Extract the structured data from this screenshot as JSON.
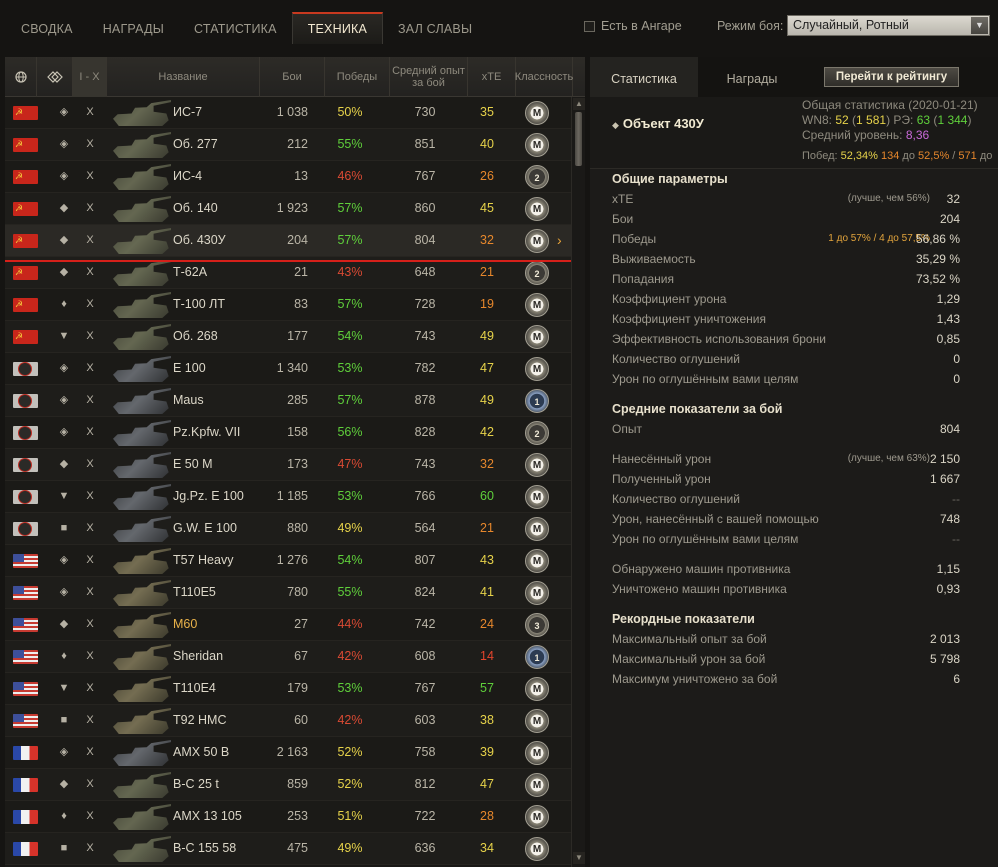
{
  "nav": {
    "tabs": [
      "СВОДКА",
      "НАГРАДЫ",
      "СТАТИСТИКА",
      "ТЕХНИКА",
      "ЗАЛ СЛАВЫ"
    ],
    "active_tab": 3,
    "hangar_label": "Есть в Ангаре",
    "mode_label": "Режим боя:",
    "mode_value": "Случайный, Ротный"
  },
  "table": {
    "headers": {
      "flag_icon": "globe-icon",
      "tier_icon": "tier-icon",
      "level": "I - X",
      "name": "Название",
      "battles": "Бои",
      "wins": "Победы",
      "exp": "Средний опыт за бой",
      "xte": "xTE",
      "class": "Классность"
    },
    "rows": [
      {
        "nation": "ussr",
        "tier": "◈",
        "level": "X",
        "name": "ИС-7",
        "battles": "1 038",
        "wins": "50%",
        "wc": "y",
        "exp": "730",
        "xte": "35",
        "xc": "y",
        "cls": "M",
        "ck": "m",
        "tank": ""
      },
      {
        "nation": "ussr",
        "tier": "◈",
        "level": "X",
        "name": "Об. 277",
        "battles": "212",
        "wins": "55%",
        "wc": "g",
        "exp": "851",
        "xte": "40",
        "xc": "y",
        "cls": "M",
        "ck": "m",
        "tank": ""
      },
      {
        "nation": "ussr",
        "tier": "◈",
        "level": "X",
        "name": "ИС-4",
        "battles": "13",
        "wins": "46%",
        "wc": "lr",
        "exp": "767",
        "xte": "26",
        "xc": "o",
        "cls": "2",
        "ck": "",
        "tank": ""
      },
      {
        "nation": "ussr",
        "tier": "◆",
        "level": "X",
        "name": "Об. 140",
        "battles": "1 923",
        "wins": "57%",
        "wc": "g",
        "exp": "860",
        "xte": "45",
        "xc": "y",
        "cls": "M",
        "ck": "m",
        "tank": ""
      },
      {
        "nation": "ussr",
        "tier": "◆",
        "level": "X",
        "name": "Об. 430У",
        "battles": "204",
        "wins": "57%",
        "wc": "g",
        "exp": "804",
        "xte": "32",
        "xc": "o",
        "cls": "M",
        "ck": "m",
        "tank": "",
        "selected": true
      },
      {
        "nation": "ussr",
        "tier": "◆",
        "level": "X",
        "name": "Т-62А",
        "battles": "21",
        "wins": "43%",
        "wc": "lr",
        "exp": "648",
        "xte": "21",
        "xc": "o",
        "cls": "2",
        "ck": "",
        "tank": ""
      },
      {
        "nation": "ussr",
        "tier": "♦",
        "level": "X",
        "name": "Т-100 ЛТ",
        "battles": "83",
        "wins": "57%",
        "wc": "g",
        "exp": "728",
        "xte": "19",
        "xc": "o",
        "cls": "M",
        "ck": "m",
        "tank": ""
      },
      {
        "nation": "ussr",
        "tier": "▼",
        "level": "X",
        "name": "Об. 268",
        "battles": "177",
        "wins": "54%",
        "wc": "g",
        "exp": "743",
        "xte": "49",
        "xc": "y",
        "cls": "M",
        "ck": "m",
        "tank": ""
      },
      {
        "nation": "ger",
        "tier": "◈",
        "level": "X",
        "name": "E 100",
        "battles": "1 340",
        "wins": "53%",
        "wc": "g",
        "exp": "782",
        "xte": "47",
        "xc": "y",
        "cls": "M",
        "ck": "m",
        "tank": "grey"
      },
      {
        "nation": "ger",
        "tier": "◈",
        "level": "X",
        "name": "Maus",
        "battles": "285",
        "wins": "57%",
        "wc": "g",
        "exp": "878",
        "xte": "49",
        "xc": "y",
        "cls": "1",
        "ck": "one",
        "tank": "grey"
      },
      {
        "nation": "ger",
        "tier": "◈",
        "level": "X",
        "name": "Pz.Kpfw. VII",
        "battles": "158",
        "wins": "56%",
        "wc": "g",
        "exp": "828",
        "xte": "42",
        "xc": "y",
        "cls": "2",
        "ck": "",
        "tank": "grey"
      },
      {
        "nation": "ger",
        "tier": "◆",
        "level": "X",
        "name": "E 50 M",
        "battles": "173",
        "wins": "47%",
        "wc": "lr",
        "exp": "743",
        "xte": "32",
        "xc": "o",
        "cls": "M",
        "ck": "m",
        "tank": "grey"
      },
      {
        "nation": "ger",
        "tier": "▼",
        "level": "X",
        "name": "Jg.Pz. E 100",
        "battles": "1 185",
        "wins": "53%",
        "wc": "g",
        "exp": "766",
        "xte": "60",
        "xc": "g",
        "cls": "M",
        "ck": "m",
        "tank": "grey"
      },
      {
        "nation": "ger",
        "tier": "■",
        "level": "X",
        "name": "G.W. E 100",
        "battles": "880",
        "wins": "49%",
        "wc": "y",
        "exp": "564",
        "xte": "21",
        "xc": "o",
        "cls": "M",
        "ck": "m",
        "tank": "grey"
      },
      {
        "nation": "usa",
        "tier": "◈",
        "level": "X",
        "name": "T57 Heavy",
        "battles": "1 276",
        "wins": "54%",
        "wc": "g",
        "exp": "807",
        "xte": "43",
        "xc": "y",
        "cls": "M",
        "ck": "m",
        "tank": "tan"
      },
      {
        "nation": "usa",
        "tier": "◈",
        "level": "X",
        "name": "T110E5",
        "battles": "780",
        "wins": "55%",
        "wc": "g",
        "exp": "824",
        "xte": "41",
        "xc": "y",
        "cls": "M",
        "ck": "m",
        "tank": "tan"
      },
      {
        "nation": "usa",
        "tier": "◆",
        "level": "X",
        "name": "M60",
        "battles": "27",
        "wins": "44%",
        "wc": "lr",
        "exp": "742",
        "xte": "24",
        "xc": "o",
        "cls": "3",
        "ck": "",
        "tank": "tan",
        "gold": true
      },
      {
        "nation": "usa",
        "tier": "♦",
        "level": "X",
        "name": "Sheridan",
        "battles": "67",
        "wins": "42%",
        "wc": "lr",
        "exp": "608",
        "xte": "14",
        "xc": "r",
        "cls": "1",
        "ck": "one",
        "tank": "tan"
      },
      {
        "nation": "usa",
        "tier": "▼",
        "level": "X",
        "name": "T110E4",
        "battles": "179",
        "wins": "53%",
        "wc": "g",
        "exp": "767",
        "xte": "57",
        "xc": "g",
        "cls": "M",
        "ck": "m",
        "tank": "tan"
      },
      {
        "nation": "usa",
        "tier": "■",
        "level": "X",
        "name": "T92 HMC",
        "battles": "60",
        "wins": "42%",
        "wc": "lr",
        "exp": "603",
        "xte": "38",
        "xc": "y",
        "cls": "M",
        "ck": "m",
        "tank": "tan"
      },
      {
        "nation": "fra",
        "tier": "◈",
        "level": "X",
        "name": "AMX 50 B",
        "battles": "2 163",
        "wins": "52%",
        "wc": "y",
        "exp": "758",
        "xte": "39",
        "xc": "y",
        "cls": "M",
        "ck": "m",
        "tank": "grey"
      },
      {
        "nation": "fra",
        "tier": "◆",
        "level": "X",
        "name": "B-C 25 t",
        "battles": "859",
        "wins": "52%",
        "wc": "y",
        "exp": "812",
        "xte": "47",
        "xc": "y",
        "cls": "M",
        "ck": "m",
        "tank": ""
      },
      {
        "nation": "fra",
        "tier": "♦",
        "level": "X",
        "name": "AMX 13 105",
        "battles": "253",
        "wins": "51%",
        "wc": "y",
        "exp": "722",
        "xte": "28",
        "xc": "o",
        "cls": "M",
        "ck": "m",
        "tank": ""
      },
      {
        "nation": "fra",
        "tier": "■",
        "level": "X",
        "name": "B-C 155 58",
        "battles": "475",
        "wins": "49%",
        "wc": "y",
        "exp": "636",
        "xte": "34",
        "xc": "y",
        "cls": "M",
        "ck": "m",
        "tank": ""
      }
    ]
  },
  "right": {
    "tabs": [
      "Статистика",
      "Награды"
    ],
    "rating_button": "Перейти к рейтингу",
    "vehicle_name": "Объект 430У",
    "summary": {
      "line1": "Общая статистика (2020-01-21)",
      "wn8_label": "WN8:",
      "wn8": "52",
      "wn8_total": "1 581",
      "re_label": "РЭ:",
      "re": "63",
      "re_total": "1 344",
      "avg_label": "Средний уровень:",
      "avg": "8,36",
      "wins_label": "Побед:",
      "wins_pct": "52,34%",
      "wins_step1": "134",
      "wins_mid": "до",
      "wins_step2": "52,5%",
      "wins_step3": "571",
      "wins_tail": "до"
    },
    "sections": [
      {
        "title": "Общие параметры",
        "rows": [
          {
            "label": "xTE",
            "value": "32",
            "vc": "o",
            "note": "(лучше, чем 56%)"
          },
          {
            "label": "Бои",
            "value": "204"
          },
          {
            "label": "Победы",
            "value": "56,86 %",
            "note": "1 до 57% / 4 до 57,5%",
            "nc": "o"
          },
          {
            "label": "Выживаемость",
            "value": "35,29 %"
          },
          {
            "label": "Попадания",
            "value": "73,52 %"
          },
          {
            "label": "Коэффициент урона",
            "value": "1,29"
          },
          {
            "label": "Коэффициент уничтожения",
            "value": "1,43"
          },
          {
            "label": "Эффективность использования брони",
            "value": "0,85"
          },
          {
            "label": "Количество оглушений",
            "value": "0"
          },
          {
            "label": "Урон по оглушённым вами целям",
            "value": "0"
          }
        ]
      },
      {
        "title": "Средние показатели за бой",
        "rows": [
          {
            "label": "Опыт",
            "value": "804"
          },
          {
            "gap": true
          },
          {
            "label": "Нанесённый урон",
            "value": "2 150",
            "vc": "y",
            "note": "(лучше, чем 63%)"
          },
          {
            "label": "Полученный урон",
            "value": "1 667"
          },
          {
            "label": "Количество оглушений",
            "value": "--",
            "dim": true
          },
          {
            "label": "Урон, нанесённый с вашей помощью",
            "value": "748"
          },
          {
            "label": "Урон по оглушённым вами целям",
            "value": "--",
            "dim": true
          },
          {
            "gap": true
          },
          {
            "label": "Обнаружено машин противника",
            "value": "1,15"
          },
          {
            "label": "Уничтожено машин противника",
            "value": "0,93"
          }
        ]
      },
      {
        "title": "Рекордные показатели",
        "rows": [
          {
            "label": "Максимальный опыт за бой",
            "value": "2 013"
          },
          {
            "label": "Максимальный урон за бой",
            "value": "5 798"
          },
          {
            "label": "Максимум уничтожено за бой",
            "value": "6"
          }
        ]
      }
    ]
  }
}
